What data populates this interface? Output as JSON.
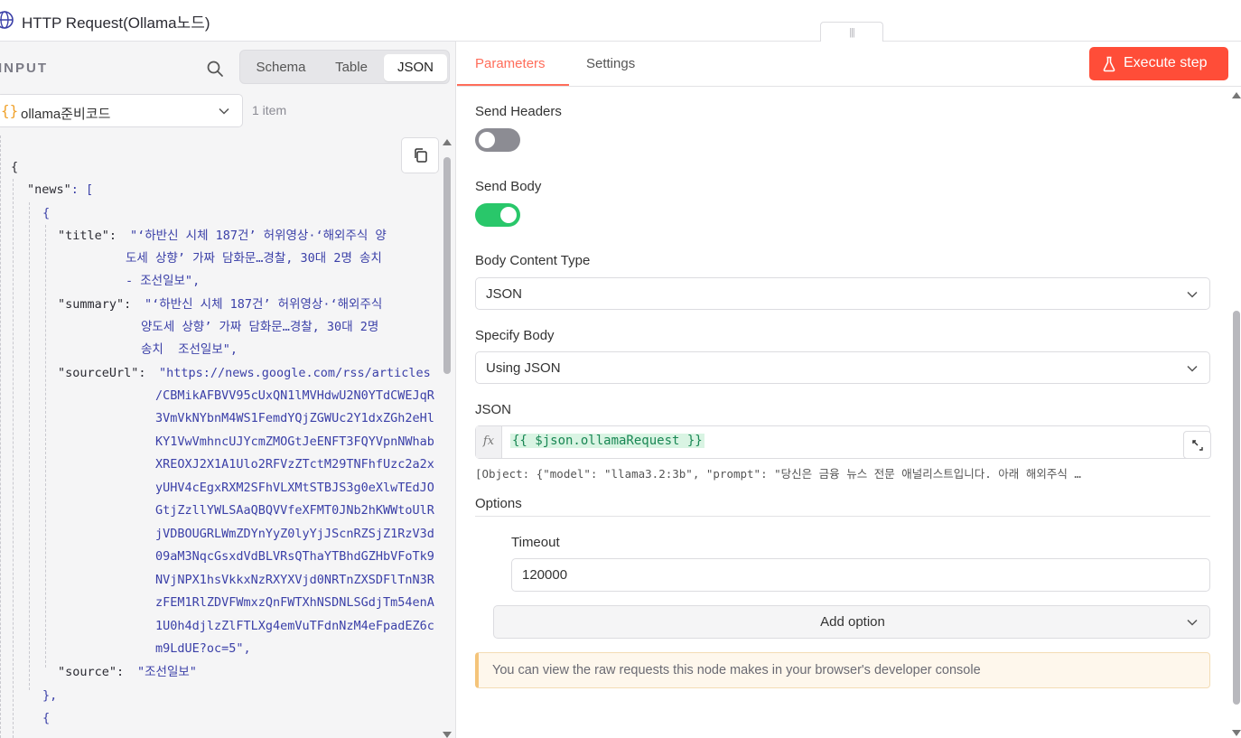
{
  "window": {
    "title": "HTTP Request(Ollama노드)",
    "drag_handle": "|||"
  },
  "input_panel": {
    "label": "INPUT",
    "view_tabs": [
      {
        "label": "Schema",
        "active": false
      },
      {
        "label": "Table",
        "active": false
      },
      {
        "label": "JSON",
        "active": true
      }
    ],
    "node_select": {
      "icon": "{}",
      "value": "ollama준비코드"
    },
    "item_count": "1 item",
    "json_lines": {
      "open_brace": "{",
      "news_key": "\"news\"",
      "news_open": ": [",
      "item_open": "{",
      "title_key": "\"title\":",
      "title_v1": "\"‘하반신 시체 187건’ 허위영상·‘해외주식 양",
      "title_v2": "도세 상향’ 가짜 담화문…경찰, 30대 2명 송치",
      "title_v3": "- 조선일보\",",
      "summary_key": "\"summary\":",
      "summary_v1": "\"‘하반신 시체 187건’ 허위영상·‘해외주식",
      "summary_v2": "양도세 상향’ 가짜 담화문…경찰, 30대 2명",
      "summary_v3": "송치  조선일보\",",
      "sourceurl_key": "\"sourceUrl\":",
      "url_v1": "\"https://news.google.com/rss/articles",
      "url_v2": "/CBMikAFBVV95cUxQN1lMVHdwU2N0YTdCWEJqR",
      "url_v3": "3VmVkNYbnM4WS1FemdYQjZGWUc2Y1dxZGh2eHl",
      "url_v4": "KY1VwVmhncUJYcmZMOGtJeENFT3FQYVpnNWhab",
      "url_v5": "XREOXJ2X1A1Ulo2RFVzZTctM29TNFhfUzc2a2x",
      "url_v6": "yUHV4cEgxRXM2SFhVLXMtSTBJS3g0eXlwTEdJO",
      "url_v7": "GtjZzllYWLSAaQBQVVfeXFMT0JNb2hKWWtoUlR",
      "url_v8": "jVDBOUGRLWmZDYnYyZ0lyYjJScnRZSjZ1RzV3d",
      "url_v9": "09aM3NqcGsxdVdBLVRsQThaYTBhdGZHbVFoTk9",
      "url_v10": "NVjNPX1hsVkkxNzRXYXVjd0NRTnZXSDFlTnN3R",
      "url_v11": "zFEM1RlZDVFWmxzQnFWTXhNSDNLSGdjTm54enA",
      "url_v12": "1U0h4djlzZlFTLXg4emVuTFdnNzM4eFpadEZ6c",
      "url_v13": "m9LdUE?oc=5\",",
      "source_key": "\"source\":",
      "source_val": "\"조선일보\"",
      "item_close": "},",
      "next_open": "{"
    }
  },
  "params_panel": {
    "tabs": [
      {
        "label": "Parameters",
        "active": true
      },
      {
        "label": "Settings",
        "active": false
      }
    ],
    "execute_label": "Execute step",
    "send_headers": {
      "label": "Send Headers",
      "on": false
    },
    "send_body": {
      "label": "Send Body",
      "on": true
    },
    "body_content_type": {
      "label": "Body Content Type",
      "value": "JSON"
    },
    "specify_body": {
      "label": "Specify Body",
      "value": "Using JSON"
    },
    "json": {
      "label": "JSON",
      "fx": "fx",
      "expression": "{{ $json.ollamaRequest }}",
      "preview": "[Object: {\"model\": \"llama3.2:3b\", \"prompt\": \"당신은 금융 뉴스 전문 애널리스트입니다. 아래 해외주식 …"
    },
    "options": {
      "title": "Options",
      "timeout_label": "Timeout",
      "timeout_value": "120000",
      "add_option": "Add option"
    },
    "notice": "You can view the raw requests this node makes in your browser's developer console"
  },
  "colors": {
    "accent": "#ff6d5a",
    "execute_bg": "#ff4d38",
    "toggle_on": "#29c76a",
    "toggle_off": "#8c8c93",
    "json_value": "#3b40a8",
    "expression_text": "#198754"
  }
}
